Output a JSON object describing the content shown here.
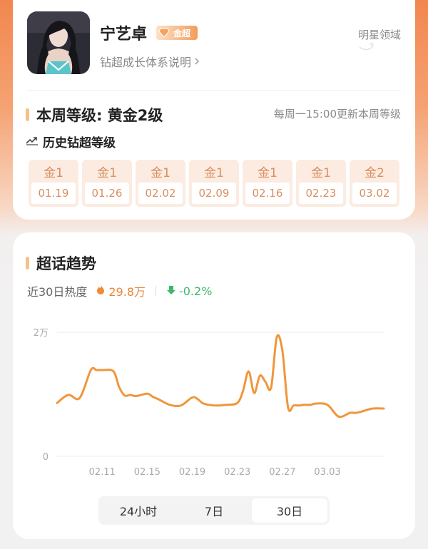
{
  "profile": {
    "name": "宁艺卓",
    "badge_label": "金超",
    "growth_link": "钻超成长体系说明",
    "realm_link": "明星领域"
  },
  "level": {
    "title": "本周等级: 黄金2级",
    "update_note": "每周一15:00更新本周等级",
    "history_title": "历史钻超等级",
    "weeks": [
      {
        "level": "金1",
        "date": "01.19"
      },
      {
        "level": "金1",
        "date": "01.26"
      },
      {
        "level": "金1",
        "date": "02.02"
      },
      {
        "level": "金1",
        "date": "02.09"
      },
      {
        "level": "金1",
        "date": "02.16"
      },
      {
        "level": "金1",
        "date": "02.23"
      },
      {
        "level": "金2",
        "date": "03.02"
      }
    ]
  },
  "trend": {
    "title": "超话趋势",
    "heat_label": "近30日热度",
    "heat_value": "29.8万",
    "change_value": "-0.2%",
    "tabs": [
      "24小时",
      "7日",
      "30日"
    ],
    "active_tab": "30日"
  },
  "colors": {
    "line": "#f0963c",
    "accent": "#f6c089",
    "heat": "#e8863b",
    "change": "#3cb86b"
  },
  "chart_data": {
    "type": "line",
    "y_tick_labels": [
      "2万",
      "0"
    ],
    "y_tick_values": [
      20000,
      0
    ],
    "ylim": [
      0,
      20000
    ],
    "x_tick_labels": [
      "02.11",
      "02.15",
      "02.19",
      "02.23",
      "02.27",
      "03.03"
    ],
    "x_tick_values": [
      0,
      4,
      8,
      12,
      16,
      20
    ],
    "xlim": [
      -4,
      25
    ],
    "grid": true,
    "series": [
      {
        "x": [
          -4,
          -3,
          -2,
          -1,
          -0.5,
          0,
          1,
          1.5,
          2,
          2.5,
          3,
          4,
          4.5,
          5,
          6,
          7,
          8,
          8.5,
          9,
          10,
          11,
          12,
          12.5,
          13,
          13.5,
          14,
          14.5,
          15,
          15.5,
          16,
          16.5,
          17,
          17.5,
          18,
          18.5,
          19,
          20,
          21,
          22,
          22.5,
          23,
          24,
          25
        ],
        "y": [
          8600,
          9900,
          9400,
          13900,
          13900,
          13900,
          13700,
          11200,
          9800,
          9900,
          9700,
          10100,
          9600,
          9200,
          8300,
          8200,
          9500,
          9200,
          8500,
          8200,
          8300,
          8600,
          10500,
          13700,
          10200,
          13000,
          12000,
          11100,
          19200,
          17000,
          7900,
          8200,
          8200,
          8300,
          8300,
          8500,
          8300,
          6400,
          7000,
          7000,
          7200,
          7700,
          7700
        ]
      }
    ]
  }
}
